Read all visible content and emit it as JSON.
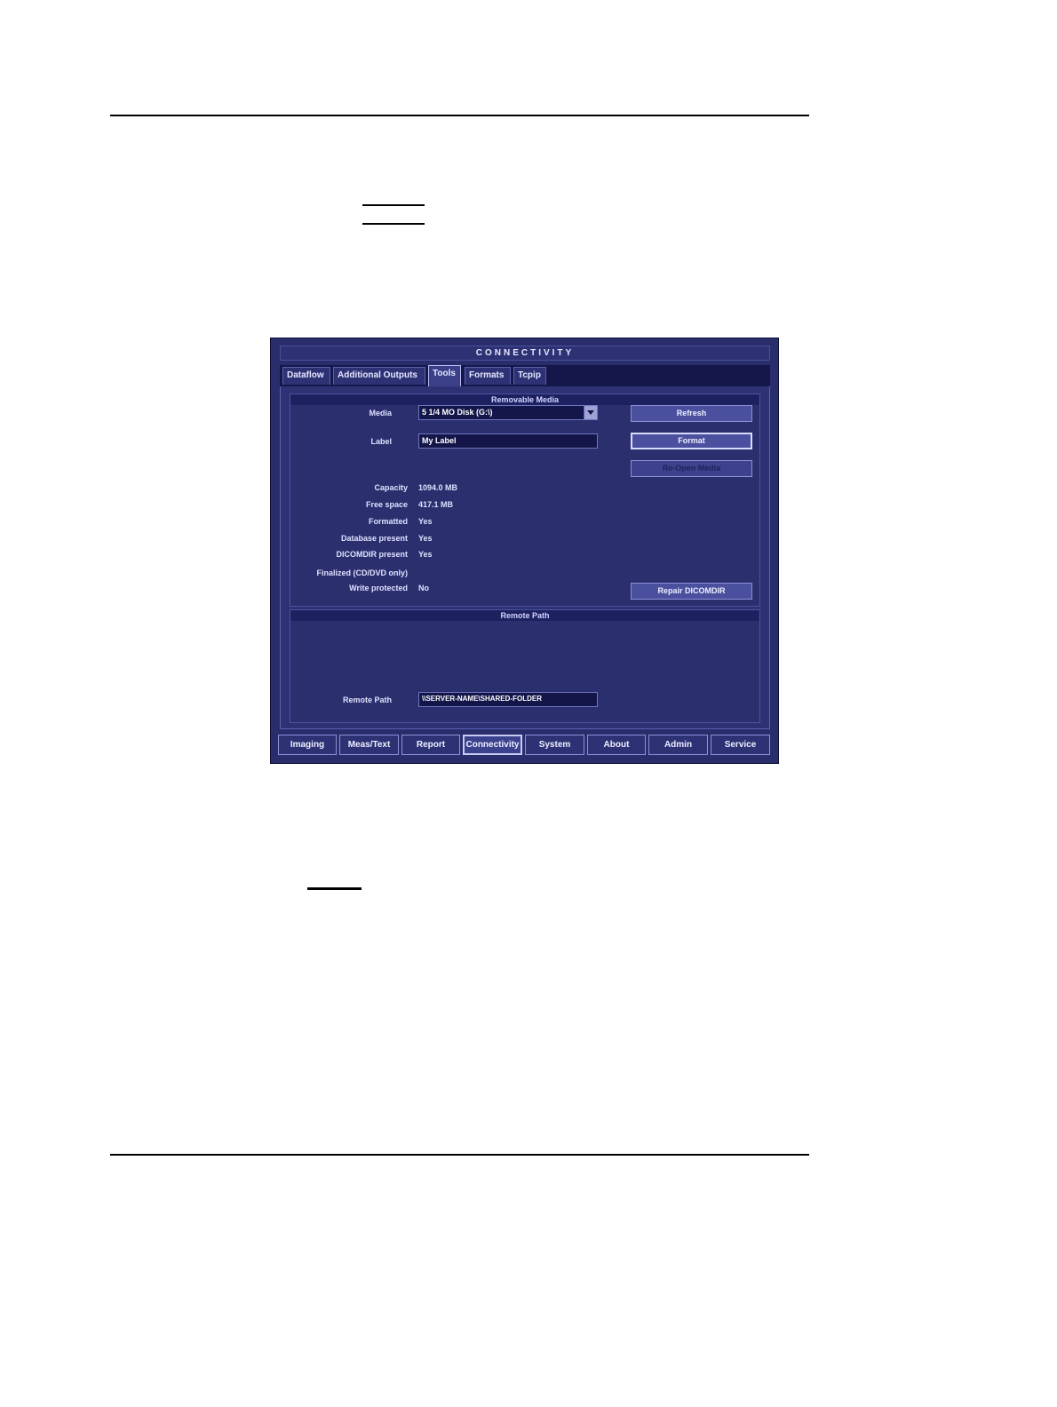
{
  "window": {
    "title": "CONNECTIVITY"
  },
  "tabs": [
    {
      "label": "Dataflow"
    },
    {
      "label": "Additional Outputs"
    },
    {
      "label": "Tools"
    },
    {
      "label": "Formats"
    },
    {
      "label": "Tcpip"
    }
  ],
  "active_tab": "Tools",
  "removable_media": {
    "heading": "Removable Media",
    "media_label": "Media",
    "media_value": "5 1/4 MO Disk    (G:\\)",
    "label_label": "Label",
    "label_value": "My Label",
    "refresh_label": "Refresh",
    "format_label": "Format",
    "reopen_label": "Re-Open Media",
    "repair_label": "Repair DICOMDIR",
    "info": [
      {
        "label": "Capacity",
        "value": "1094.0 MB"
      },
      {
        "label": "Free space",
        "value": "417.1 MB"
      },
      {
        "label": "Formatted",
        "value": "Yes"
      },
      {
        "label": "Database present",
        "value": "Yes"
      },
      {
        "label": "DICOMDIR present",
        "value": "Yes"
      },
      {
        "label": "Finalized (CD/DVD only)",
        "value": ""
      },
      {
        "label": "Write protected",
        "value": "No"
      }
    ]
  },
  "remote_path": {
    "heading": "Remote Path",
    "label": "Remote Path",
    "value": "\\\\SERVER-NAME\\SHARED-FOLDER"
  },
  "bottom_nav": [
    {
      "label": "Imaging"
    },
    {
      "label": "Meas/Text"
    },
    {
      "label": "Report"
    },
    {
      "label": "Connectivity"
    },
    {
      "label": "System"
    },
    {
      "label": "About"
    },
    {
      "label": "Admin"
    },
    {
      "label": "Service"
    }
  ],
  "active_bottom": "Connectivity",
  "colors": {
    "panel": "#2e3274",
    "tab_strip": "#15174a",
    "field": "#14164a"
  }
}
